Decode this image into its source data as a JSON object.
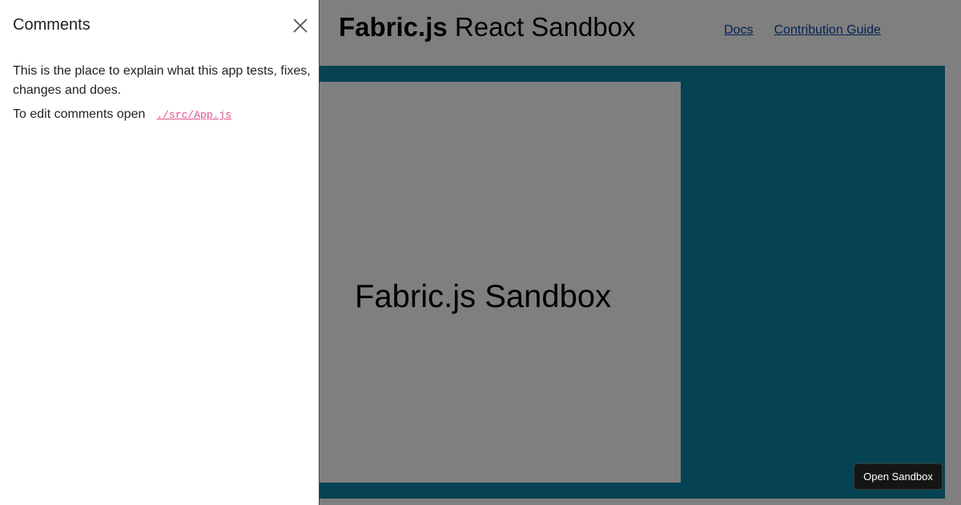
{
  "app": {
    "title_bold": "Fabric.js",
    "title_rest": " React Sandbox",
    "nav": {
      "docs": "Docs",
      "contribution_guide": "Contribution Guide"
    },
    "canvas_text": "Fabric.js Sandbox"
  },
  "drawer": {
    "title": "Comments",
    "close_icon": "close-icon",
    "paragraph_1": "This is the place to explain what this app tests, fixes, changes and does.",
    "paragraph_2_prefix": "To edit comments open",
    "file_link": "./src/App.js"
  },
  "floating": {
    "open_sandbox_label": "Open Sandbox"
  },
  "colors": {
    "stage": "#0d87a4",
    "overlay": "rgba(0,0,0,0.5)",
    "link": "#0645ad",
    "code_link": "#e0528c"
  }
}
